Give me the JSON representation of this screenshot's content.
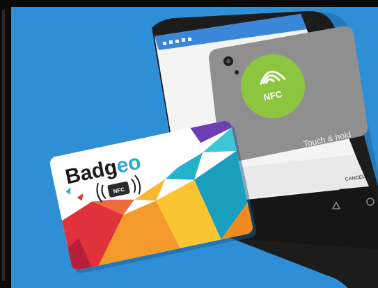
{
  "card": {
    "brand_prefix": "Badg",
    "brand_suffix": "eo",
    "nfc_mark": "NFC"
  },
  "phone": {
    "nfc_badge_label": "NFC",
    "instruction": "Touch & hold",
    "cancel_label": "CANCEL"
  },
  "colors": {
    "background_blue": "#2f8fd6",
    "nfc_green": "#8cc63f",
    "phone_body": "#1c1c1c",
    "status_bar_blue": "#3a86d8",
    "card_red": "#e0323a",
    "card_teal": "#21b3c7",
    "card_orange": "#f49a2a"
  }
}
